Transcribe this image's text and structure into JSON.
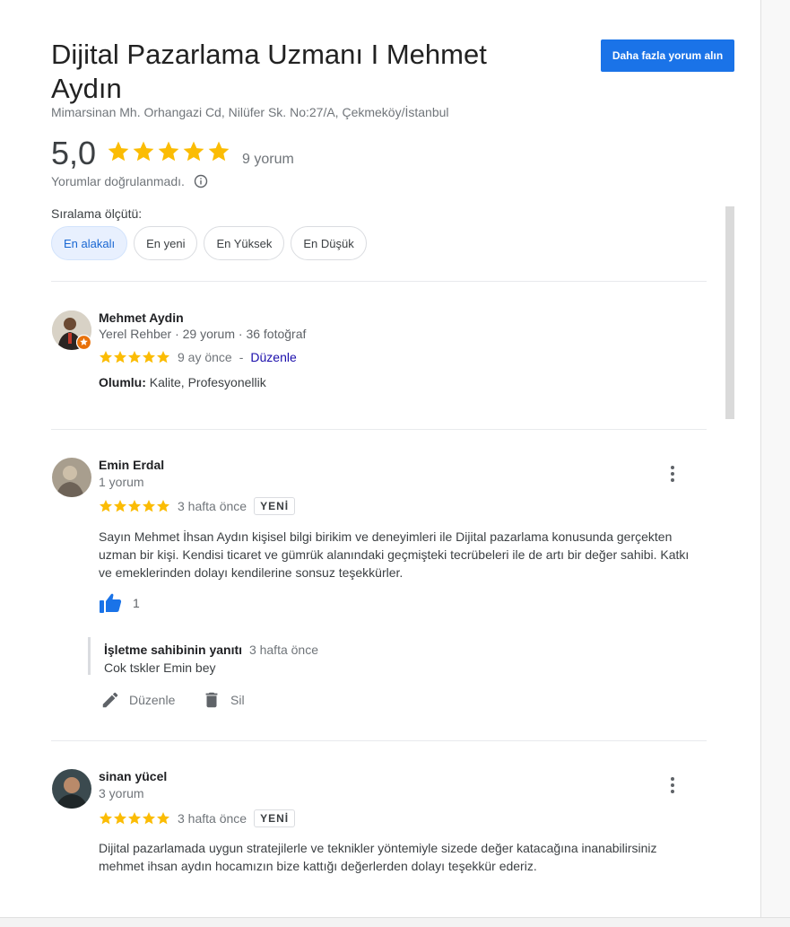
{
  "header": {
    "title": "Dijital Pazarlama Uzmanı I Mehmet Aydın",
    "address": "Mimarsinan Mh. Orhangazi Cd, Nilüfer Sk. No:27/A, Çekmeköy/İstanbul",
    "more_reviews_button": "Daha fazla yorum alın",
    "rating": "5,0",
    "rating_value": 5,
    "review_count": "9 yorum",
    "unverified": "Yorumlar doğrulanmadı."
  },
  "sort": {
    "label": "Sıralama ölçütü:",
    "options": [
      "En alakalı",
      "En yeni",
      "En Yüksek",
      "En Düşük"
    ],
    "selected": "En alakalı"
  },
  "reviews": [
    {
      "name": "Mehmet Aydin",
      "meta": "Yerel Rehber · 29 yorum · 36 fotoğraf",
      "stars": 5,
      "time": "9 ay önce",
      "separator": "-",
      "edit": "Düzenle",
      "positive_label": "Olumlu:",
      "positive_value": "Kalite, Profesyonellik"
    },
    {
      "name": "Emin Erdal",
      "meta": "1 yorum",
      "stars": 5,
      "time": "3 hafta önce",
      "badge": "YENİ",
      "text": "Sayın Mehmet İhsan Aydın kişisel bilgi birikim ve deneyimleri ile Dijital pazarlama konusunda gerçekten uzman bir kişi. Kendisi ticaret ve gümrük alanındaki geçmişteki tecrübeleri ile de artı bir değer sahibi. Katkı ve emeklerinden dolayı kendilerine sonsuz teşekkürler.",
      "likes": "1",
      "owner_reply_label": "İşletme sahibinin yanıtı",
      "owner_reply_time": "3 hafta önce",
      "owner_reply_text": "Cok tskler Emin bey",
      "edit_action": "Düzenle",
      "delete_action": "Sil"
    },
    {
      "name": "sinan yücel",
      "meta": "3 yorum",
      "stars": 5,
      "time": "3 hafta önce",
      "badge": "YENİ",
      "text": "Dijital pazarlamada uygun stratejilerle ve teknikler yöntemiyle sizede değer katacağına inanabilirsiniz mehmet ihsan aydın hocamızın bize kattığı  değerlerden dolayı teşekkür ederiz."
    }
  ],
  "colors": {
    "accent": "#1a73e8",
    "star": "#fbbc04",
    "chip_active_bg": "#e8f0fe"
  }
}
